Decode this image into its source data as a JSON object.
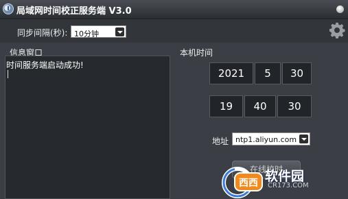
{
  "window": {
    "title": "局域网时间校正服务端 V3.0"
  },
  "toolbar": {
    "sync_interval_label": "同步间隔(秒):",
    "sync_interval_value": "10分钟"
  },
  "info": {
    "label": "信息窗口",
    "log": "时间服务端启动成功!"
  },
  "time": {
    "label": "本机时间",
    "year": "2021",
    "month": "5",
    "day": "30",
    "hour": "19",
    "minute": "40",
    "second": "30"
  },
  "address": {
    "label": "地址",
    "value": "ntp1.aliyun.com"
  },
  "sync_button": {
    "label": "在线校时"
  },
  "watermark": {
    "text": "软件园",
    "site": "CR173.COM"
  },
  "icons": [
    "app-icon",
    "gear-icon",
    "chevron-down-icon",
    "close-icon"
  ]
}
